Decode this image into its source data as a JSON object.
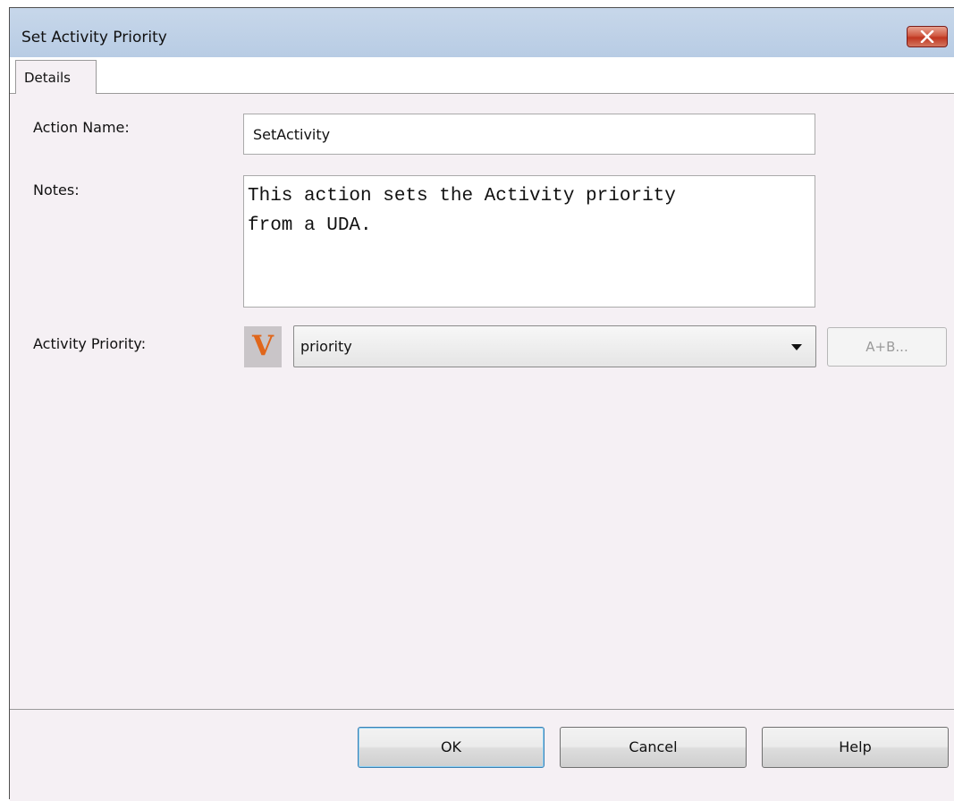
{
  "window": {
    "title": "Set Activity Priority",
    "close_glyph": "✕"
  },
  "tabs": [
    {
      "label": "Details",
      "selected": true
    }
  ],
  "form": {
    "action_name_label": "Action Name:",
    "action_name_value": "SetActivity",
    "notes_label": "Notes:",
    "notes_value": "This action sets the Activity priority\nfrom a UDA.",
    "activity_priority_label": "Activity Priority:",
    "variable_icon_letter": "V",
    "activity_priority_value": "priority",
    "expression_button_label": "A+B...",
    "expression_button_enabled": false
  },
  "buttons": {
    "ok_label": "OK",
    "cancel_label": "Cancel",
    "help_label": "Help"
  },
  "colors": {
    "titlebar": "#c7d7ea",
    "dialog_background": "#f5f0f4",
    "variable_icon": "#e0661b",
    "close_button": "#c03620"
  }
}
